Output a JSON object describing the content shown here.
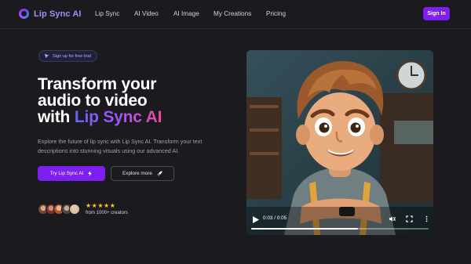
{
  "nav": {
    "brand": "Lip Sync AI",
    "links": [
      "Lip Sync",
      "AI Video",
      "AI Image",
      "My Creations",
      "Pricing"
    ],
    "signin_label": "Sign In"
  },
  "hero": {
    "badge": "Sign up for free trial",
    "headline_line1": "Transform your",
    "headline_line2": "audio to video",
    "headline_line3_prefix": "with ",
    "headline_line3_highlight": "Lip Sync AI",
    "subtext": "Explore the future of lip sync with Lip Sync AI. Transform your text descriptions into stunning visuals using our advanced AI.",
    "primary_button": "Try Lip Sync AI",
    "secondary_button": "Explore more",
    "rating_stars": 5,
    "social_proof": "from 1000+ creators"
  },
  "video": {
    "time": "0:03 / 0:05",
    "progress": 0.6
  },
  "colors": {
    "background": "#1b1a1e",
    "accent": "#7c1ff0",
    "brand_text": "#a78bfa",
    "star": "#facc15"
  },
  "icons": {
    "logo": "ring-logo-icon",
    "badge": "cursor-arrow-icon",
    "primary_button": "lightning-icon",
    "secondary_button": "rocket-icon",
    "video_controls": [
      "play-icon",
      "volume-icon",
      "fullscreen-icon",
      "more-vertical-icon"
    ]
  }
}
